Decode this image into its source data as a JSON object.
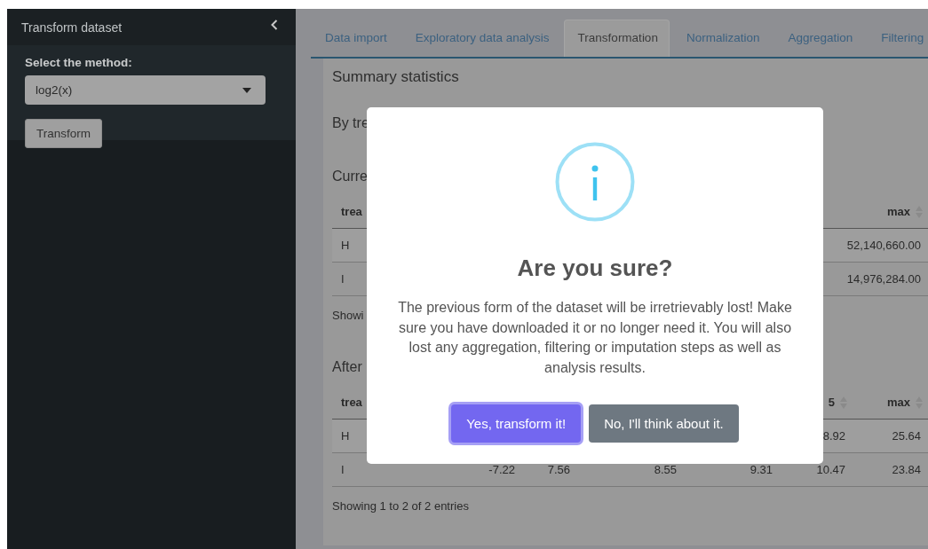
{
  "sidebar": {
    "title": "Transform dataset",
    "method_label": "Select the method:",
    "method_select": {
      "value": "log2(x)"
    },
    "transform_button": "Transform"
  },
  "tabs": [
    {
      "label": "Data import",
      "selected": false
    },
    {
      "label": "Exploratory data analysis",
      "selected": false
    },
    {
      "label": "Transformation",
      "selected": true
    },
    {
      "label": "Normalization",
      "selected": false
    },
    {
      "label": "Aggregation",
      "selected": false
    },
    {
      "label": "Filtering",
      "selected": false
    }
  ],
  "card": {
    "title": "Summary statistics",
    "subtitle": "By tre",
    "sections": [
      {
        "heading": "Curre",
        "table": {
          "columns": [
            "trea",
            null,
            null,
            null,
            null,
            null,
            "max"
          ],
          "rows": [
            {
              "cells": [
                "H",
                null,
                null,
                null,
                null,
                null,
                "52,140,660.00"
              ]
            },
            {
              "cells": [
                "I",
                null,
                null,
                null,
                null,
                null,
                "14,976,284.00"
              ]
            }
          ]
        },
        "info": "Showi"
      },
      {
        "heading": "After",
        "table": {
          "columns": [
            "trea",
            null,
            null,
            null,
            null,
            "5",
            "max"
          ],
          "rows": [
            {
              "cells": [
                "H",
                null,
                null,
                null,
                null,
                "8.92",
                "25.64"
              ]
            },
            {
              "cells": [
                "I",
                "-7.22",
                "7.56",
                "8.55",
                "9.31",
                "10.47",
                "23.84"
              ]
            }
          ]
        },
        "info": "Showing 1 to 2 of 2 entries"
      }
    ]
  },
  "dialog": {
    "title": "Are you sure?",
    "message": "The previous form of the dataset will be irretrievably lost! Make sure you have downloaded it or no longer need it. You will also lost any aggregation, filtering or imputation steps as well as analysis results.",
    "buttons": [
      {
        "label": "Yes, transform it!",
        "kind": "confirm",
        "focused": true
      },
      {
        "label": "No, I'll think about it.",
        "kind": "cancel",
        "focused": false
      }
    ]
  }
}
